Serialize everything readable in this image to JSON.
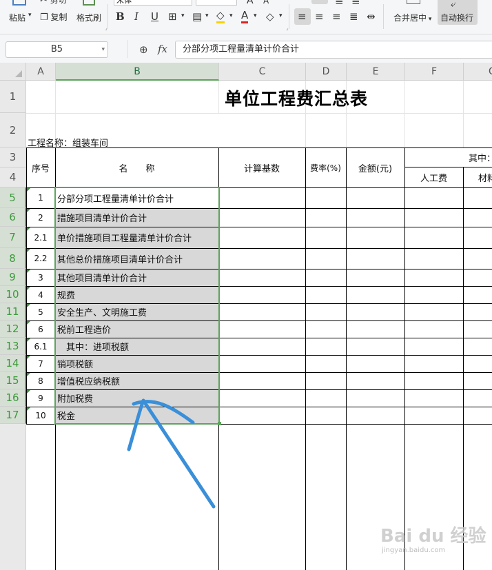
{
  "toolbar": {
    "paste": "粘贴",
    "cut": "剪切",
    "copy": "复制",
    "format_painter": "格式刷",
    "font_name": "宋体",
    "bold": "B",
    "italic": "I",
    "underline": "U",
    "merge_center": "合并居中",
    "auto_wrap": "自动换行"
  },
  "formula_bar": {
    "cell_ref": "B5",
    "fx": "fx",
    "formula": "分部分项工程量清单计价合计"
  },
  "columns": [
    "A",
    "B",
    "C",
    "D",
    "E",
    "F",
    "G"
  ],
  "row_numbers": [
    "1",
    "2",
    "3",
    "4",
    "5",
    "6",
    "7",
    "8",
    "9",
    "10",
    "11",
    "12",
    "13",
    "14",
    "15",
    "16",
    "17"
  ],
  "sheet": {
    "title": "单位工程费汇总表",
    "project_label": "工程名称：组装车间",
    "headers": {
      "seq": "序号",
      "name": "名　　称",
      "base": "计算基数",
      "rate": "费率(%)",
      "amount": "金额(元)",
      "among": "其中：",
      "labor": "人工费",
      "material": "材料"
    },
    "rows": [
      {
        "seq": "1",
        "name": "分部分项工程量清单计价合计"
      },
      {
        "seq": "2",
        "name": "措施项目清单计价合计"
      },
      {
        "seq": "2.1",
        "name": "单价措施项目工程量清单计价合计"
      },
      {
        "seq": "2.2",
        "name": "其他总价措施项目清单计价合计"
      },
      {
        "seq": "3",
        "name": "其他项目清单计价合计"
      },
      {
        "seq": "4",
        "name": "规费"
      },
      {
        "seq": "5",
        "name": "安全生产、文明施工费"
      },
      {
        "seq": "6",
        "name": "税前工程造价"
      },
      {
        "seq": "6.1",
        "name": "　其中：进项税额"
      },
      {
        "seq": "7",
        "name": "销项税额"
      },
      {
        "seq": "8",
        "name": "增值税应纳税额"
      },
      {
        "seq": "9",
        "name": "附加税费"
      },
      {
        "seq": "10",
        "name": "税金"
      }
    ]
  },
  "watermark": {
    "brand": "Bai du 经验",
    "url": "jingyan.baidu.com"
  },
  "colors": {
    "selection": "#5ca35c",
    "annotation": "#3a8fd9",
    "shade": "#d8d8d8"
  }
}
